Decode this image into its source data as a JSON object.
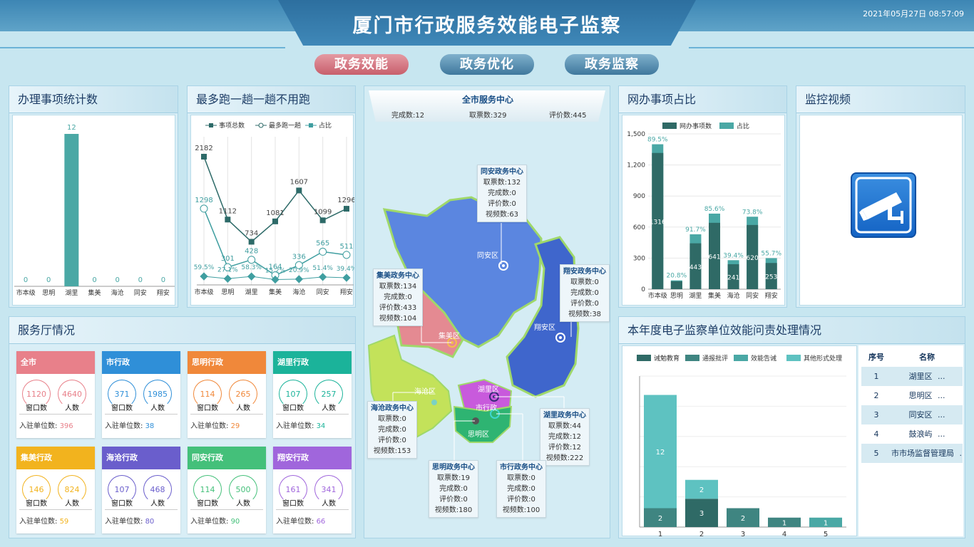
{
  "header": {
    "title": "厦门市行政服务效能电子监察",
    "datetime": "2021年05月27日 08:57:09"
  },
  "tabs": [
    {
      "label": "政务效能",
      "active": true
    },
    {
      "label": "政务优化",
      "active": false
    },
    {
      "label": "政务监察",
      "active": false
    }
  ],
  "panels": {
    "stats": "办理事项统计数",
    "run_once": "最多跑一趟一趟不用跑",
    "center": "全市服务中心",
    "online": "网办事项占比",
    "video": "监控视频",
    "halls": "服务厅情况",
    "accountability": "本年度电子监察单位效能问责处理情况"
  },
  "center_summary": {
    "done": "完成数:12",
    "taken": "取票数:329",
    "rating": "评价数:445"
  },
  "colors": {
    "teal": "#4aa8a5",
    "dark": "#2f6a66",
    "line_dark": "#2d6a68",
    "line_light": "#3f9ea0"
  },
  "chart_data": [
    {
      "type": "bar",
      "title": "办理事项统计数",
      "categories": [
        "市本级",
        "思明",
        "湖里",
        "集美",
        "海沧",
        "同安",
        "翔安"
      ],
      "values": [
        0,
        0,
        12,
        0,
        0,
        0,
        0
      ],
      "ylim": [
        0,
        12
      ]
    },
    {
      "type": "line",
      "title": "最多跑一趟一趟不用跑",
      "categories": [
        "市本级",
        "思明",
        "湖里",
        "集美",
        "海沧",
        "同安",
        "翔安"
      ],
      "legend": [
        "事项总数",
        "最多跑一趟",
        "占比"
      ],
      "series": [
        {
          "name": "事项总数",
          "values": [
            2182,
            1112,
            734,
            1081,
            1607,
            1099,
            1296
          ]
        },
        {
          "name": "最多跑一趟",
          "values": [
            1298,
            301,
            428,
            164,
            336,
            565,
            511
          ]
        },
        {
          "name": "占比",
          "labels": [
            "59.5%",
            "27.1%",
            "58.3%",
            "15.2%",
            "20.9%",
            "51.4%",
            "39.4%"
          ]
        }
      ]
    },
    {
      "type": "bar",
      "title": "网办事项占比",
      "categories": [
        "市本级",
        "思明",
        "湖里",
        "集美",
        "海沧",
        "同安",
        "翔安"
      ],
      "legend": [
        "网办事项数",
        "占比"
      ],
      "yticks": [
        "0",
        "300",
        "600",
        "900",
        "1,200",
        "1,500"
      ],
      "ylim": [
        0,
        1500
      ],
      "series": [
        {
          "name": "网办事项数",
          "values": [
            1316,
            76,
            443,
            641,
            241,
            620,
            253
          ]
        },
        {
          "name": "占比",
          "values": [
            1400,
            85,
            530,
            730,
            280,
            700,
            300
          ],
          "labels": [
            "89.5%",
            "20.8%",
            "91.7%",
            "85.6%",
            "39.4%",
            "73.8%",
            "55.7%"
          ]
        }
      ]
    },
    {
      "type": "bar",
      "title": "本年度电子监察单位效能问责处理情况",
      "categories": [
        "1",
        "2",
        "3",
        "4",
        "5"
      ],
      "legend": [
        "诫勉教育",
        "通报批评",
        "效能告诫",
        "其他形式处理"
      ],
      "series": [
        {
          "name": "诫勉教育",
          "values": [
            0,
            3,
            0,
            0,
            0
          ]
        },
        {
          "name": "通报批评",
          "values": [
            2,
            0,
            2,
            1,
            0
          ]
        },
        {
          "name": "效能告诫",
          "values": [
            0,
            0,
            0,
            0,
            1
          ]
        },
        {
          "name": "其他形式处理",
          "values": [
            12,
            2,
            0,
            0,
            0
          ]
        }
      ],
      "ylim": [
        0,
        16
      ]
    }
  ],
  "halls": [
    {
      "name": "全市",
      "color": "#e8808a",
      "a": "1120",
      "b": "4640",
      "units": "396"
    },
    {
      "name": "市行政",
      "color": "#2f8fd8",
      "a": "371",
      "b": "1985",
      "units": "38"
    },
    {
      "name": "思明行政",
      "color": "#f0883a",
      "a": "114",
      "b": "265",
      "units": "29"
    },
    {
      "name": "湖里行政",
      "color": "#1bb39a",
      "a": "107",
      "b": "257",
      "units": "34"
    },
    {
      "name": "集美行政",
      "color": "#f2b31e",
      "a": "146",
      "b": "824",
      "units": "59"
    },
    {
      "name": "海沧行政",
      "color": "#6a5ecc",
      "a": "107",
      "b": "468",
      "units": "80"
    },
    {
      "name": "同安行政",
      "color": "#44c07a",
      "a": "114",
      "b": "500",
      "units": "90"
    },
    {
      "name": "翔安行政",
      "color": "#a066dc",
      "a": "161",
      "b": "341",
      "units": "66"
    }
  ],
  "hall_labels": {
    "windows": "窗口数",
    "people": "人数",
    "units_prefix": "入驻单位数: "
  },
  "map_boxes": [
    {
      "title": "同安政务中心",
      "lines": [
        "取票数:132",
        "完成数:0",
        "评价数:0",
        "视频数:63"
      ]
    },
    {
      "title": "集美政务中心",
      "lines": [
        "取票数:134",
        "完成数:0",
        "评价数:433",
        "视频数:104"
      ]
    },
    {
      "title": "翔安政务中心",
      "lines": [
        "取票数:0",
        "完成数:0",
        "评价数:0",
        "视频数:38"
      ]
    },
    {
      "title": "海沧政务中心",
      "lines": [
        "取票数:0",
        "完成数:0",
        "评价数:0",
        "视频数:153"
      ]
    },
    {
      "title": "湖里政务中心",
      "lines": [
        "取票数:44",
        "完成数:12",
        "评价数:12",
        "视频数:222"
      ]
    },
    {
      "title": "思明政务中心",
      "lines": [
        "取票数:19",
        "完成数:0",
        "评价数:0",
        "视频数:180"
      ]
    },
    {
      "title": "市行政务中心",
      "lines": [
        "取票数:0",
        "完成数:0",
        "评价数:0",
        "视频数:100"
      ]
    }
  ],
  "map_regions": [
    "同安区",
    "翔安区",
    "集美区",
    "海沧区",
    "湖里区",
    "市行政",
    "思明区"
  ],
  "rank_table": {
    "headers": [
      "序号",
      "名称"
    ],
    "rows": [
      [
        "1",
        "湖里区"
      ],
      [
        "2",
        "思明区"
      ],
      [
        "3",
        "同安区"
      ],
      [
        "4",
        "鼓浪屿"
      ],
      [
        "5",
        "市市场监督管理局"
      ]
    ],
    "more": "..."
  }
}
